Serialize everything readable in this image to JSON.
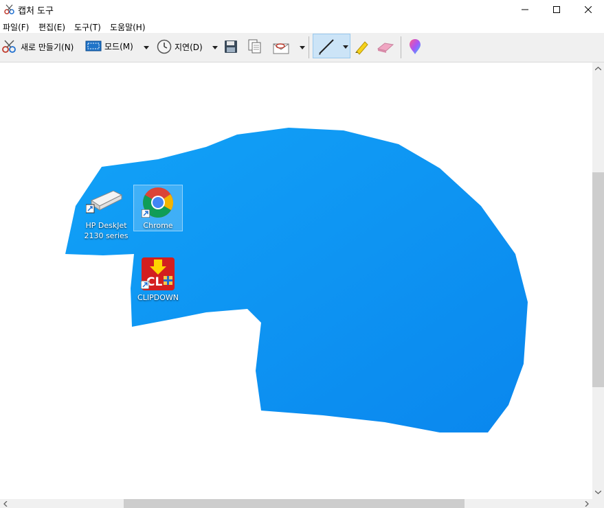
{
  "window": {
    "title": "캡처 도구",
    "app_icon": "scissors-icon"
  },
  "menu": {
    "items": [
      "파일(F)",
      "편집(E)",
      "도구(T)",
      "도움말(H)"
    ]
  },
  "toolbar": {
    "new_label": "새로 만들기(N)",
    "mode_label": "모드(M)",
    "delay_label": "지연(D)",
    "icons": [
      "new-snip-icon",
      "mode-icon",
      "delay-clock-icon",
      "save-icon",
      "copy-icon",
      "send-email-icon",
      "pen-icon",
      "highlighter-icon",
      "eraser-icon",
      "paint3d-icon"
    ]
  },
  "desktop_icons": [
    {
      "line1": "HP DeskJet",
      "line2": "2130 series"
    },
    {
      "line1": "Chrome",
      "line2": ""
    },
    {
      "line1": "CLIPDOWN",
      "line2": ""
    }
  ],
  "colors": {
    "capture_blue": "#0a8ff0",
    "toolbar_bg": "#f0f0f0",
    "pen_selected": "#cce4f7"
  }
}
